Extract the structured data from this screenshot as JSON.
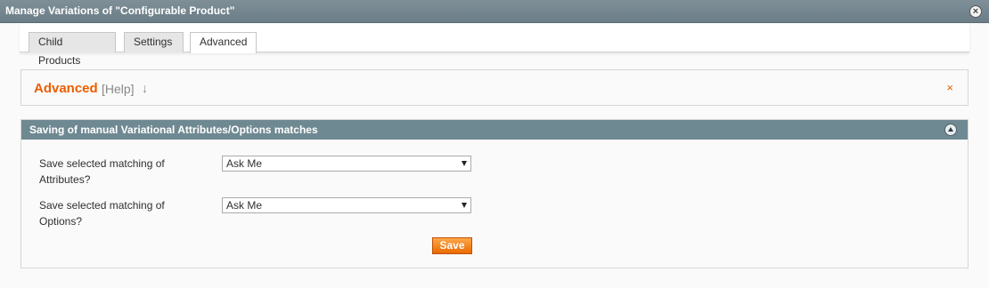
{
  "window": {
    "title": "Manage Variations of \"Configurable Product\""
  },
  "tabs": [
    {
      "label": "Child Products"
    },
    {
      "label": "Settings"
    },
    {
      "label": "Advanced"
    }
  ],
  "advanced": {
    "heading": "Advanced",
    "help": "[Help]",
    "help_arrow": "↓",
    "close": "×"
  },
  "fieldset": {
    "title": "Saving of manual Variational Attributes/Options matches",
    "fields": [
      {
        "label": "Save selected matching of Attributes?",
        "value": "Ask Me"
      },
      {
        "label": "Save selected matching of Options?",
        "value": "Ask Me"
      }
    ],
    "save_label": "Save"
  },
  "colors": {
    "accent": "#eb5e00",
    "header": "#6f8992",
    "button": "#f18200"
  }
}
